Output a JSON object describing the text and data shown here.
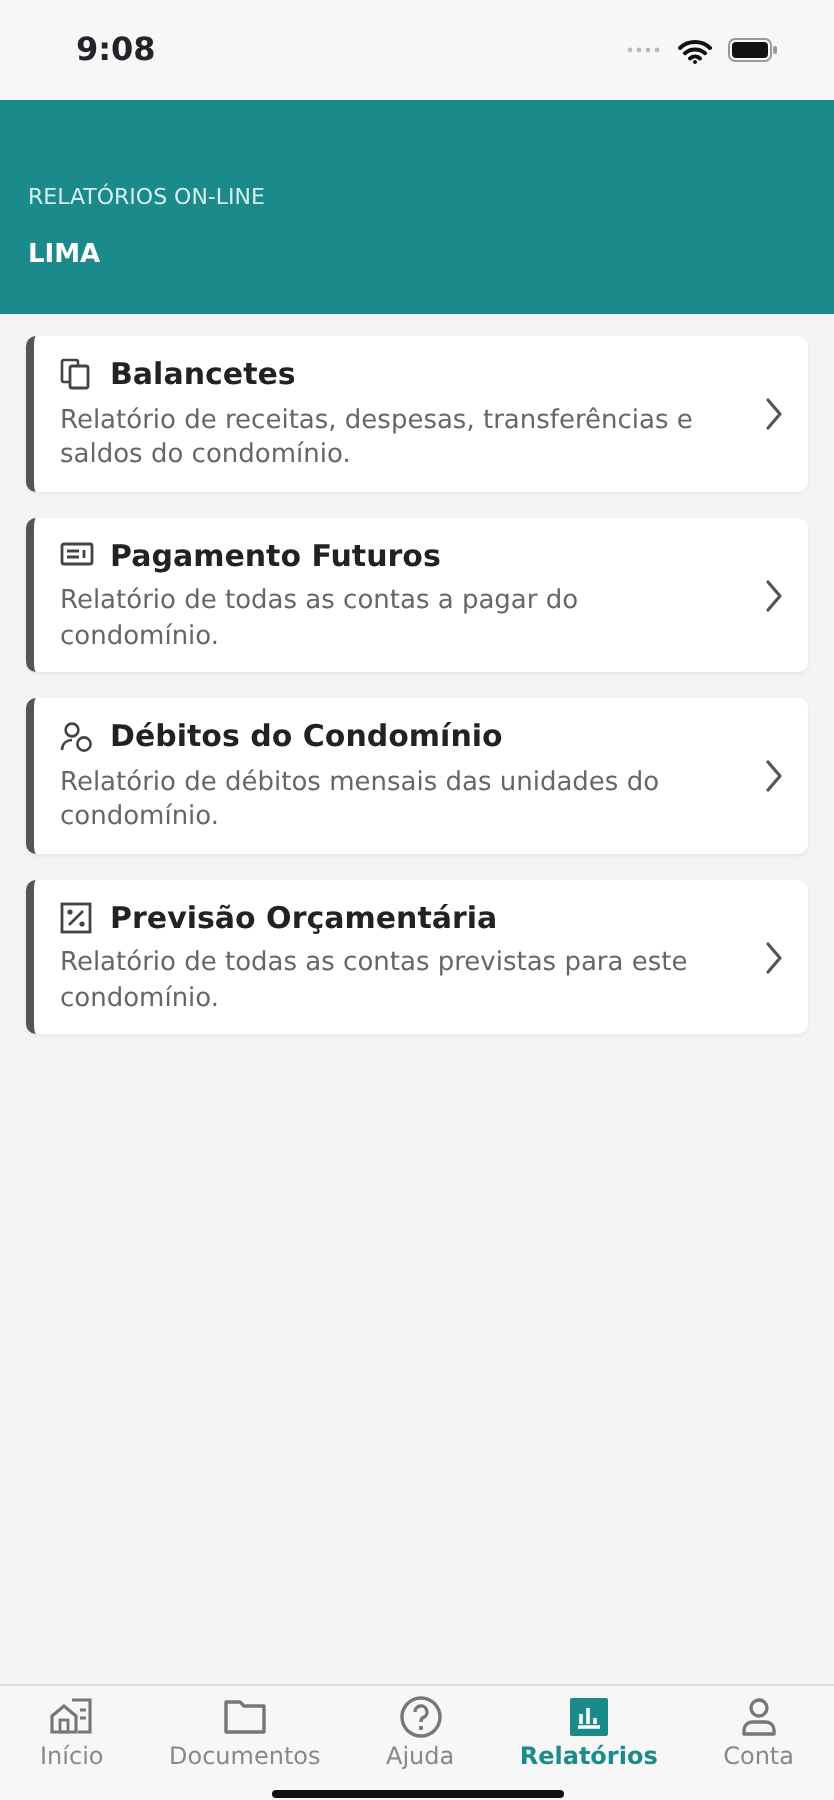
{
  "status_bar": {
    "time": "9:08"
  },
  "header": {
    "subtitle": "RELATÓRIOS ON-LINE",
    "title": "LIMA"
  },
  "reports": [
    {
      "kind": "copy",
      "title": "Balancetes",
      "description": "Relatório de receitas, despesas, transferências e saldos do condomínio."
    },
    {
      "kind": "card",
      "title": "Pagamento Futuros",
      "description": "Relatório de todas as contas a pagar do condomínio."
    },
    {
      "kind": "people",
      "title": "Débitos do Condomínio",
      "description": "Relatório de débitos mensais das unidades do condomínio."
    },
    {
      "kind": "percent",
      "title": "Previsão Orçamentária",
      "description": "Relatório de todas as contas previstas para este condomínio."
    }
  ],
  "tab_bar": [
    {
      "kind": "home",
      "label": "Início",
      "selected": false
    },
    {
      "kind": "folder",
      "label": "Documentos",
      "selected": false
    },
    {
      "kind": "help",
      "label": "Ajuda",
      "selected": false
    },
    {
      "kind": "chart",
      "label": "Relatórios",
      "selected": true
    },
    {
      "kind": "user",
      "label": "Conta",
      "selected": false
    }
  ]
}
